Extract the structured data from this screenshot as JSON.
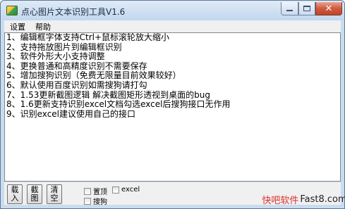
{
  "window": {
    "title": "点心图片文本识别工具V1.6"
  },
  "title_buttons": {
    "close": "✕"
  },
  "menu": [
    {
      "label": "设置"
    },
    {
      "label": "帮助"
    }
  ],
  "text_lines": [
    "1、编辑框字体支持Ctrl+鼠标滚轮放大缩小",
    "2、支持拖放图片到编辑框识别",
    "3、软件外形大小支持调整",
    "4、更换普通和高精度识别不需要保存",
    "5、增加搜狗识别（免费无限量目前效果较好）",
    "6、默认使用百度识别如需搜狗请打勾",
    "7、1.53更新截图逻辑 解决截图矩形透视到桌面的bug",
    "8、1.6更新支持识别excel文档勾选excel后搜狗接口无作用",
    "9、识别excel建议使用自己的接口"
  ],
  "buttons": {
    "load": "载入",
    "screenshot": "截图",
    "clear": "清空"
  },
  "checkboxes": {
    "topmost": "置顶",
    "excel": "excel",
    "sogou": "搜狗"
  },
  "watermark": {
    "part1": "快吧软件",
    "part2": "Fast8.com"
  }
}
